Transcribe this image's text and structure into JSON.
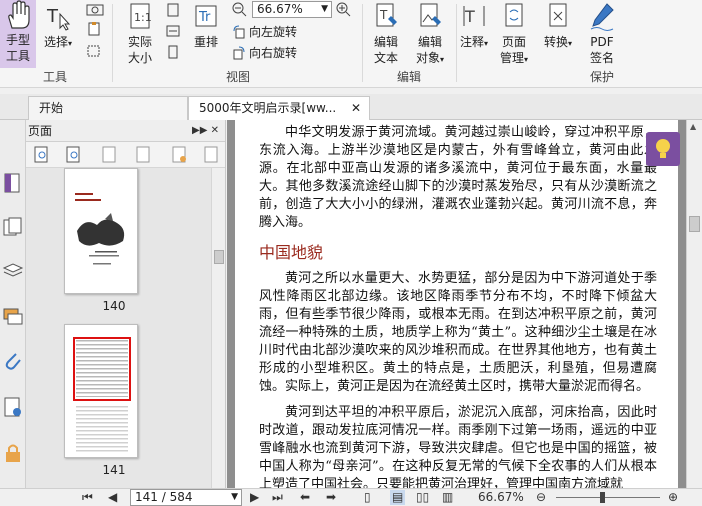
{
  "ribbon": {
    "hand": {
      "line1": "手型",
      "line2": "工具"
    },
    "select": {
      "label": "选择"
    },
    "group_tools": "工具",
    "actual_size": {
      "line1": "实际",
      "line2": "大小"
    },
    "reflow": "重排",
    "zoom_value": "66.67%",
    "rotate_left": "向左旋转",
    "rotate_right": "向右旋转",
    "group_view": "视图",
    "edit_text": {
      "line1": "编辑",
      "line2": "文本"
    },
    "edit_object": {
      "line1": "编辑",
      "line2": "对象"
    },
    "group_edit": "编辑",
    "annotate": "注释",
    "page_manage": {
      "line1": "页面",
      "line2": "管理"
    },
    "convert": "转换",
    "pdf_sign": {
      "line1": "PDF",
      "line2": "签名"
    },
    "group_protect": "保护"
  },
  "tabs": {
    "start": "开始",
    "doc": "5000年文明启示录[ww..."
  },
  "panel": {
    "title": "页面",
    "thumbs": [
      {
        "label": "140"
      },
      {
        "label": "141"
      }
    ]
  },
  "document": {
    "p1": "中华文明发源于黄河流域。黄河越过崇山峻岭，穿过冲积平原，东流入海。上游半沙漠地区是内蒙古，外有雪峰耸立，黄河由此发源。在北部中亚高山发源的诸多溪流中，黄河位于最东面，水量最大。其他多数溪流途经山脚下的沙漠时蒸发殆尽，只有从沙漠断流之前，创造了大大小小的绿洲，灌溉农业蓬勃兴起。黄河川流不息，奔腾入海。",
    "heading": "中国地貌",
    "p2": "黄河之所以水量更大、水势更猛，部分是因为中下游河道处于季风性降雨区北部边缘。该地区降雨季节分布不均，不时降下倾盆大雨，但有些季节很少降雨，或根本无雨。在到达冲积平原之前，黄河流经一种特殊的土质，地质学上称为“黄土”。这种细沙尘土壤是在冰川时代由北部沙漠吹来的风沙堆积而成。在世界其他地方，也有黄土形成的小型堆积区。黄土的特点是，土质肥沃，利垦殖，但易遭腐蚀。实际上，黄河正是因为在流经黄土区时，携带大量淤泥而得名。",
    "p3": "黄河到达平坦的冲积平原后，淤泥沉入底部，河床抬高，因此时时改道，跟动发拉底河情况一样。雨季刚下过第一场雨，遥远的中亚雪峰融水也流到黄河下游，导致洪灾肆虐。但它也是中国的摇篮，被中国人称为“母亲河”。在这种反复无常的气候下全农事的人们从根本上塑造了中国社会。只要能把黄河治理好，管理中国南方流域就"
  },
  "status": {
    "page": "141 / 584",
    "zoom": "66.67%"
  }
}
